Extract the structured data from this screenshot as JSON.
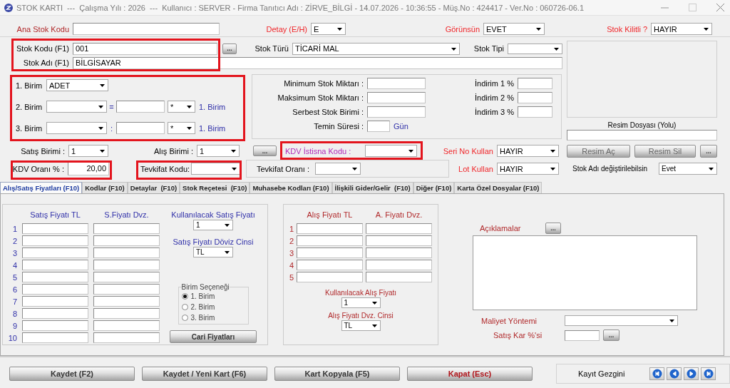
{
  "window": {
    "title": "STOK KARTI  ---  Çalışma Yılı : 2026  ---  Kullanıcı : SERVER - Firma Tanıtıcı Adı : ZİRVE_BİLGİ - 14.07.2026 - 10:36:55 - Müş.No : 424417 - Ver.No : 060726-06.1"
  },
  "top_row": {
    "ana_stok_kodu": {
      "label": "Ana Stok Kodu"
    },
    "detay": {
      "label": "Detay (E/H)",
      "value": "E"
    },
    "gorunsun": {
      "label": "Görünsün",
      "value": "EVET"
    },
    "stok_kilitli": {
      "label": "Stok Kilitli ?",
      "value": "HAYIR"
    }
  },
  "stock_identity": {
    "highlighted": true,
    "stok_kodu": {
      "label": "Stok Kodu (F1)",
      "value": "001"
    },
    "stok_adi": {
      "label": "Stok Adı (F1)",
      "value": "BİLGİSAYAR"
    },
    "browse_button": "..."
  },
  "stok_turu": {
    "label": "Stok Türü",
    "value": "TİCARİ MAL"
  },
  "stok_tipi": {
    "label": "Stok Tipi"
  },
  "units": {
    "highlighted": true,
    "rows": [
      {
        "label": "1. Birim",
        "kind": "main",
        "value": "ADET"
      },
      {
        "label": "2. Birim",
        "kind": "conversion",
        "separator": "=",
        "operator": "*",
        "unit_ref": "1. Birim"
      },
      {
        "label": "3. Birim",
        "kind": "conversion",
        "separator": ":",
        "operator": "*",
        "unit_ref": "1. Birim"
      }
    ]
  },
  "stock_limits": [
    {
      "label": "Minimum Stok Miktarı :"
    },
    {
      "label": "Maksimum Stok Miktarı :"
    },
    {
      "label": "Serbest Stok Birimi :"
    },
    {
      "label": "Temin Süresi :",
      "suffix": "Gün"
    }
  ],
  "discounts": [
    {
      "label": "İndirim 1 %"
    },
    {
      "label": "İndirim 2 %"
    },
    {
      "label": "İndirim 3 %"
    }
  ],
  "image": {
    "path_label": "Resim Dosyası (Yolu)",
    "buttons": [
      "Resim Aç",
      "Resim Sil",
      "..."
    ]
  },
  "row_sales": {
    "satis_birimi": {
      "label": "Satış Birimi :",
      "value": "1"
    },
    "alis_birimi": {
      "label": "Alış Birimi :",
      "value": "1"
    },
    "button": "...",
    "kdv_istisna": {
      "label": "KDV İstisna Kodu :",
      "highlighted": true
    },
    "seri_no": {
      "label": "Seri No Kullan",
      "value": "HAYIR"
    }
  },
  "row_tax": {
    "kdv_orani": {
      "label": "KDV Oranı % :",
      "value": "20,00",
      "highlighted": true
    },
    "tevkifat_kodu": {
      "label": "Tevkifat Kodu:",
      "highlighted": true
    },
    "tevkifat_orani": {
      "label": "Tevkifat Oranı :"
    },
    "lot": {
      "label": "Lot Kullan",
      "value": "HAYIR"
    },
    "stok_adi_degisir": {
      "label": "Stok Adı değiştirilebilsin",
      "value": "Evet"
    }
  },
  "tabs": [
    {
      "label": "Alış/Satış Fiyatları (F10)",
      "selected": true
    },
    {
      "label": "Kodlar (F10)",
      "selected": false
    },
    {
      "label": "Detaylar  (F10)",
      "selected": false
    },
    {
      "label": "Stok Reçetesi  (F10)",
      "selected": false
    },
    {
      "label": "Muhasebe Kodları (F10)",
      "selected": false
    },
    {
      "label": "İlişkili Gider/Gelir  (F10)",
      "selected": false
    },
    {
      "label": "Diğer (F10)",
      "selected": false
    },
    {
      "label": "Karta Özel Dosyalar (F10)",
      "selected": false
    }
  ],
  "sales_prices": {
    "columns": [
      "Satış Fiyatı TL",
      "S.Fiyatı Dvz."
    ],
    "rows": [
      "1",
      "2",
      "3",
      "4",
      "5",
      "6",
      "7",
      "8",
      "9",
      "10"
    ],
    "price_select": {
      "label": "Kullanılacak Satış Fiyatı",
      "value": "1"
    },
    "currency": {
      "label": "Satış Fiyatı Döviz Cinsi",
      "value": "TL"
    },
    "unit_option": {
      "title": "Birim Seçeneği",
      "options": [
        {
          "label": "1. Birim",
          "selected": true
        },
        {
          "label": "2. Birim",
          "selected": false
        },
        {
          "label": "3. Birim",
          "selected": false
        }
      ]
    },
    "button": "Cari Fiyatları"
  },
  "purchase_prices": {
    "columns": [
      "Alış Fiyatı TL",
      "A. Fiyatı Dvz."
    ],
    "rows": [
      "1",
      "2",
      "3",
      "4",
      "5"
    ],
    "price_select": {
      "label": "Kullanılacak Alış Fiyatı",
      "value": "1"
    },
    "currency": {
      "label": "Alış Fiyatı Dvz. Cinsi",
      "value": "TL"
    }
  },
  "notes": {
    "label": "Açıklamalar",
    "button": "...",
    "cost_method": {
      "label": "Maliyet Yöntemi"
    },
    "profit": {
      "label": "Satış Kar %'si",
      "button": "..."
    }
  },
  "footer": {
    "buttons": [
      {
        "label": "Kaydet (F2)",
        "kind": "normal"
      },
      {
        "label": "Kaydet / Yeni Kart (F6)",
        "kind": "normal"
      },
      {
        "label": "Kart Kopyala (F5)",
        "kind": "normal"
      },
      {
        "label": "Kapat (Esc)",
        "kind": "danger"
      }
    ],
    "navigator": {
      "label": "Kayıt Gezgini"
    }
  }
}
